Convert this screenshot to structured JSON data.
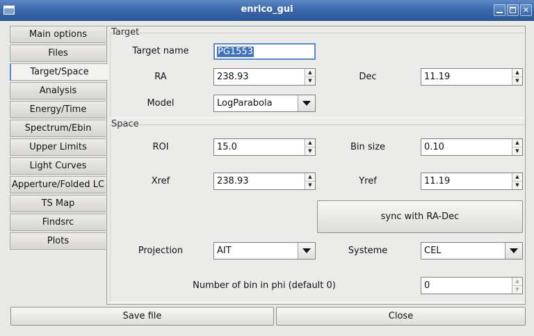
{
  "window": {
    "title": "enrico_gui"
  },
  "tabs": [
    {
      "label": "Main options"
    },
    {
      "label": "Files"
    },
    {
      "label": "Target/Space"
    },
    {
      "label": "Analysis"
    },
    {
      "label": "Energy/Time"
    },
    {
      "label": "Spectrum/Ebin"
    },
    {
      "label": "Upper Limits"
    },
    {
      "label": "Light Curves"
    },
    {
      "label": "Apperture/Folded LC"
    },
    {
      "label": "TS Map"
    },
    {
      "label": "Findsrc"
    },
    {
      "label": "Plots"
    }
  ],
  "active_tab": "Target/Space",
  "target": {
    "group_title": "Target",
    "name_label": "Target name",
    "name_value": "PG1553",
    "ra_label": "RA",
    "ra_value": "238.93",
    "dec_label": "Dec",
    "dec_value": "11.19",
    "model_label": "Model",
    "model_value": "LogParabola"
  },
  "space": {
    "group_title": "Space",
    "roi_label": "ROI",
    "roi_value": "15.0",
    "binsize_label": "Bin size",
    "binsize_value": "0.10",
    "xref_label": "Xref",
    "xref_value": "238.93",
    "yref_label": "Yref",
    "yref_value": "11.19",
    "sync_label": "sync with RA-Dec",
    "projection_label": "Projection",
    "projection_value": "AIT",
    "systeme_label": "Systeme",
    "systeme_value": "CEL",
    "phibin_label": "Number of bin in phi (default 0)",
    "phibin_value": "0"
  },
  "footer": {
    "save_label": "Save file",
    "close_label": "Close"
  }
}
